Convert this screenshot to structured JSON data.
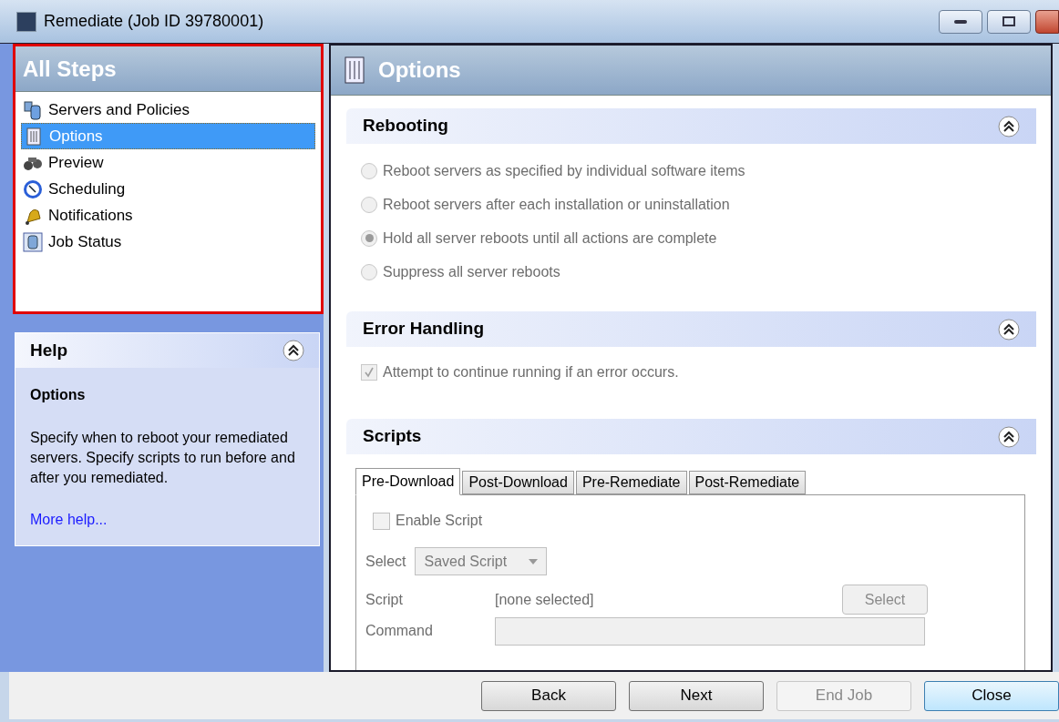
{
  "window": {
    "title": "Remediate (Job ID 39780001)"
  },
  "steps": {
    "title": "All Steps",
    "items": [
      {
        "label": "Servers and Policies",
        "selected": false
      },
      {
        "label": "Options",
        "selected": true
      },
      {
        "label": "Preview",
        "selected": false
      },
      {
        "label": "Scheduling",
        "selected": false
      },
      {
        "label": "Notifications",
        "selected": false
      },
      {
        "label": "Job Status",
        "selected": false
      }
    ]
  },
  "help": {
    "title": "Help",
    "expanded": true,
    "heading": "Options",
    "text": "Specify when to reboot your remediated servers. Specify scripts to run before and after you remediated.",
    "link": "More help..."
  },
  "options": {
    "title": "Options",
    "rebooting": {
      "title": "Rebooting",
      "expanded": true,
      "disabled": true,
      "choices": [
        {
          "label": "Reboot servers as specified by individual software items",
          "selected": false
        },
        {
          "label": "Reboot servers after each installation or uninstallation",
          "selected": false
        },
        {
          "label": "Hold all server reboots until all actions are complete",
          "selected": true
        },
        {
          "label": "Suppress all server reboots",
          "selected": false
        }
      ]
    },
    "error_handling": {
      "title": "Error Handling",
      "expanded": true,
      "checkbox": {
        "label": "Attempt to continue running if an error occurs.",
        "checked": true,
        "disabled": true
      }
    },
    "scripts": {
      "title": "Scripts",
      "expanded": true,
      "tabs": [
        {
          "label": "Pre-Download",
          "selected": true
        },
        {
          "label": "Post-Download",
          "selected": false
        },
        {
          "label": "Pre-Remediate",
          "selected": false
        },
        {
          "label": "Post-Remediate",
          "selected": false
        }
      ],
      "enable": {
        "label": "Enable Script",
        "checked": false
      },
      "select_label": "Select",
      "select_value": "Saved Script",
      "script_label": "Script",
      "script_value": "[none selected]",
      "script_button": "Select",
      "command_label": "Command"
    }
  },
  "buttons": [
    {
      "label": "Back",
      "disabled": false,
      "default": false
    },
    {
      "label": "Next",
      "disabled": false,
      "default": false
    },
    {
      "label": "End Job",
      "disabled": true,
      "default": false
    },
    {
      "label": "Close",
      "disabled": false,
      "default": true
    }
  ]
}
